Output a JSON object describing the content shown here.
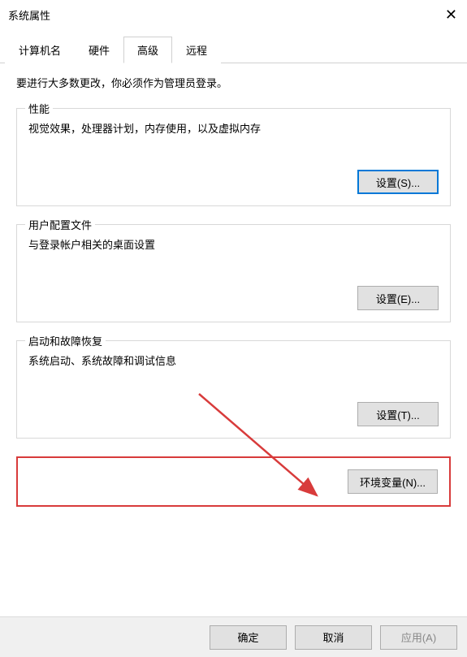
{
  "window": {
    "title": "系统属性"
  },
  "tabs": {
    "computer_name": "计算机名",
    "hardware": "硬件",
    "advanced": "高级",
    "remote": "远程"
  },
  "advanced": {
    "admin_note": "要进行大多数更改，你必须作为管理员登录。",
    "performance": {
      "title": "性能",
      "desc": "视觉效果，处理器计划，内存使用，以及虚拟内存",
      "button": "设置(S)..."
    },
    "user_profiles": {
      "title": "用户配置文件",
      "desc": "与登录帐户相关的桌面设置",
      "button": "设置(E)..."
    },
    "startup_recovery": {
      "title": "启动和故障恢复",
      "desc": "系统启动、系统故障和调试信息",
      "button": "设置(T)..."
    },
    "env_vars_button": "环境变量(N)..."
  },
  "footer": {
    "ok": "确定",
    "cancel": "取消",
    "apply": "应用(A)"
  }
}
